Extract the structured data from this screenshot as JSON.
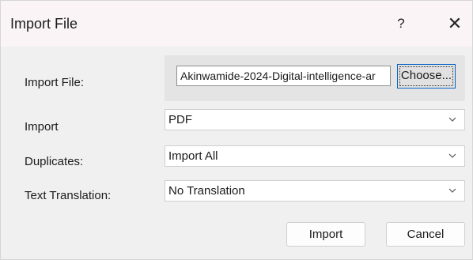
{
  "window": {
    "title": "Import File",
    "help_label": "?",
    "close_label": "✕"
  },
  "form": {
    "import_file_label": "Import File:",
    "file_value": "Akinwamide-2024-Digital-intelligence-ar",
    "choose_label": "Choose...",
    "import_label": "Import",
    "import_value": "PDF",
    "duplicates_label": "Duplicates:",
    "duplicates_value": "Import All",
    "translation_label": "Text Translation:",
    "translation_value": "No Translation"
  },
  "buttons": {
    "import_label": "Import",
    "cancel_label": "Cancel"
  },
  "icons": {
    "dropdown": "chevron-down-icon"
  }
}
